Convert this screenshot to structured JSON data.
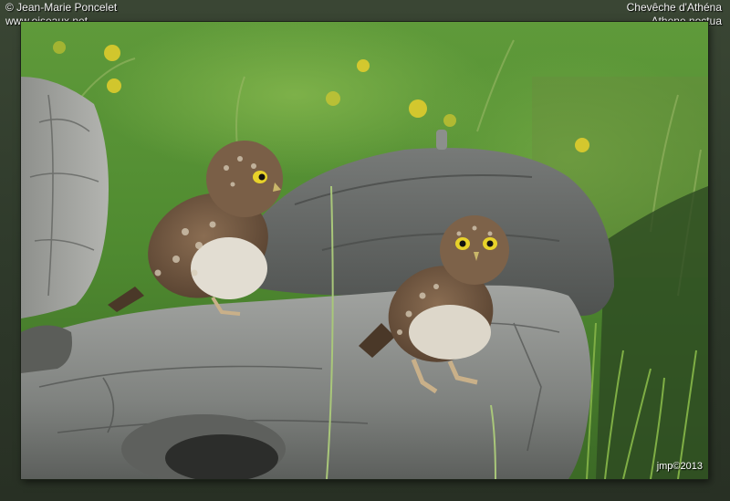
{
  "credit": {
    "copyright": "© Jean-Marie Poncelet",
    "website": "www.oiseaux.net"
  },
  "species": {
    "common_name": "Chevêche d'Athéna",
    "latin_name": "Athene noctua"
  },
  "signature": "jmp©2013",
  "colors": {
    "frame": "#2f3a2b",
    "grass": "#6aa03c",
    "log": "#8a8c8a",
    "owl": "#6e5540",
    "eye": "#e8d22a"
  }
}
